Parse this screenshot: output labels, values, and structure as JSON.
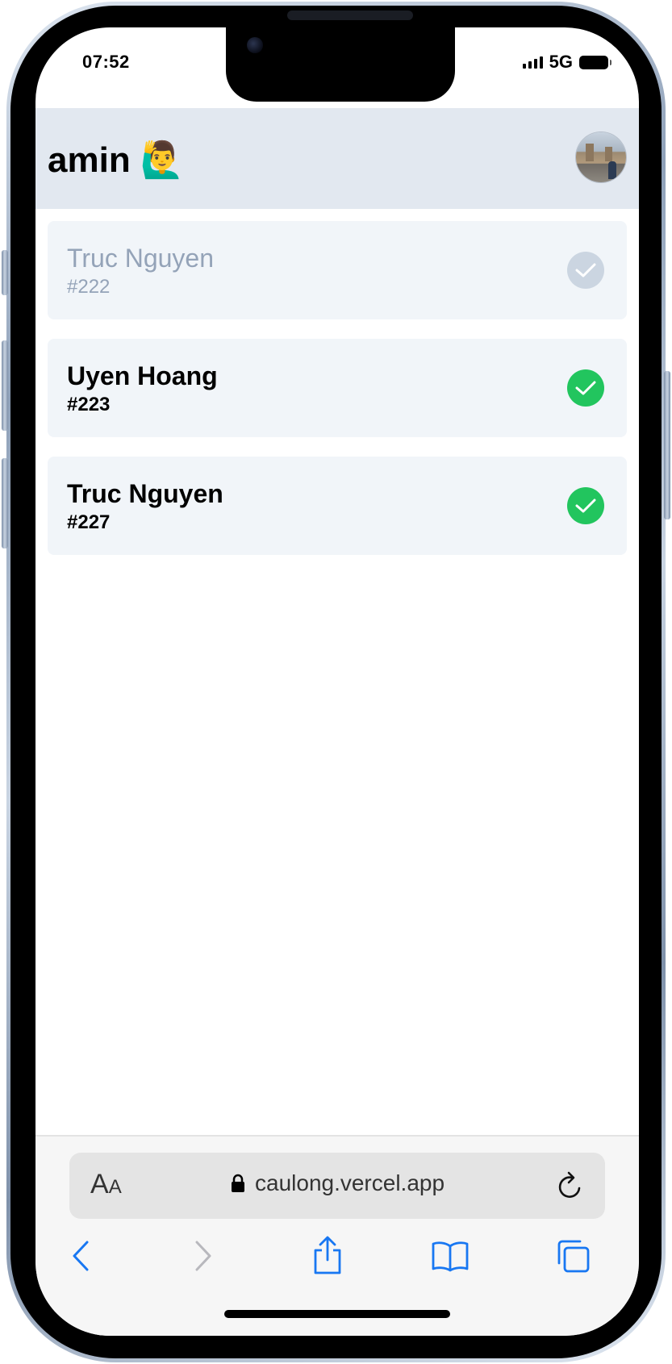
{
  "status_bar": {
    "time": "07:52",
    "network": "5G"
  },
  "header": {
    "title": "amin 🙋‍♂️"
  },
  "tickets": [
    {
      "name": "Truc Nguyen",
      "number": "#222",
      "state": "done"
    },
    {
      "name": "Uyen Hoang",
      "number": "#223",
      "state": "active"
    },
    {
      "name": "Truc Nguyen",
      "number": "#227",
      "state": "active"
    }
  ],
  "browser": {
    "text_size_label": "AA",
    "url": "caulong.vercel.app"
  },
  "colors": {
    "header_bg": "#e2e8f0",
    "card_bg": "#f1f5f9",
    "check_green": "#22c55e",
    "check_grey": "#cbd5e1",
    "ios_blue": "#1877f2"
  }
}
